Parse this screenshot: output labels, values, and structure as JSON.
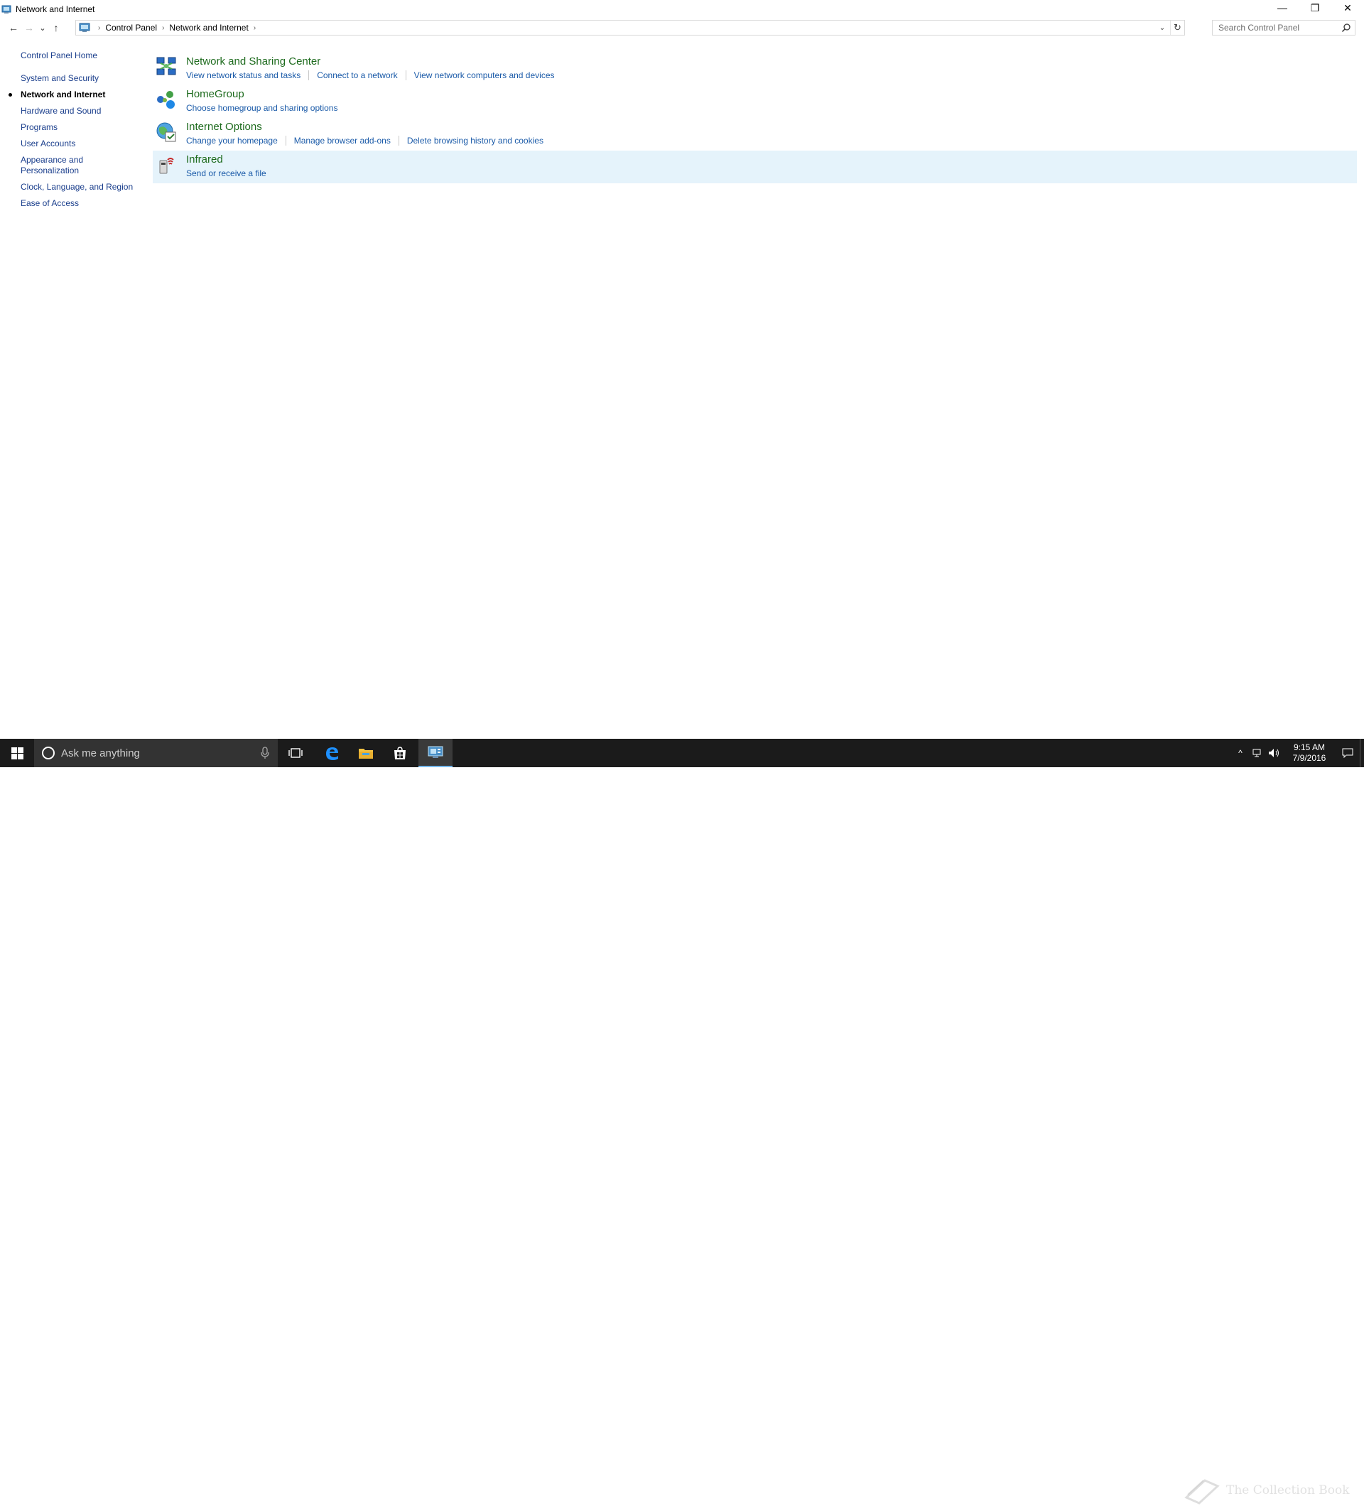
{
  "window": {
    "title": "Network and Internet",
    "controls": {
      "minimize": "—",
      "restore": "❐",
      "close": "✕"
    }
  },
  "nav": {
    "back": "←",
    "forward": "→",
    "recent": "⌄",
    "up": "↑"
  },
  "address": {
    "breadcrumbs": [
      "Control Panel",
      "Network and Internet"
    ],
    "separator": "›",
    "dropdown": "⌄",
    "refresh": "↻"
  },
  "search": {
    "placeholder": "Search Control Panel"
  },
  "leftnav": {
    "home": "Control Panel Home",
    "items": [
      {
        "label": "System and Security",
        "current": false
      },
      {
        "label": "Network and Internet",
        "current": true
      },
      {
        "label": "Hardware and Sound",
        "current": false
      },
      {
        "label": "Programs",
        "current": false
      },
      {
        "label": "User Accounts",
        "current": false
      },
      {
        "label": "Appearance and Personalization",
        "current": false
      },
      {
        "label": "Clock, Language, and Region",
        "current": false
      },
      {
        "label": "Ease of Access",
        "current": false
      }
    ]
  },
  "categories": [
    {
      "title": "Network and Sharing Center",
      "icon": "network-sharing-icon",
      "links": [
        "View network status and tasks",
        "Connect to a network",
        "View network computers and devices"
      ]
    },
    {
      "title": "HomeGroup",
      "icon": "homegroup-icon",
      "links": [
        "Choose homegroup and sharing options"
      ]
    },
    {
      "title": "Internet Options",
      "icon": "internet-options-icon",
      "links": [
        "Change your homepage",
        "Manage browser add-ons",
        "Delete browsing history and cookies"
      ]
    },
    {
      "title": "Infrared",
      "icon": "infrared-icon",
      "links": [
        "Send or receive a file"
      ],
      "highlighted": true
    }
  ],
  "taskbar": {
    "search_placeholder": "Ask me anything",
    "clock_time": "9:15 AM",
    "clock_date": "7/9/2016",
    "watermark": "The Collection Book"
  },
  "colors": {
    "link": "#1a5aa8",
    "category_title": "#1e6b1e",
    "highlight": "#e5f3fb",
    "taskbar": "#1b1b1b"
  }
}
